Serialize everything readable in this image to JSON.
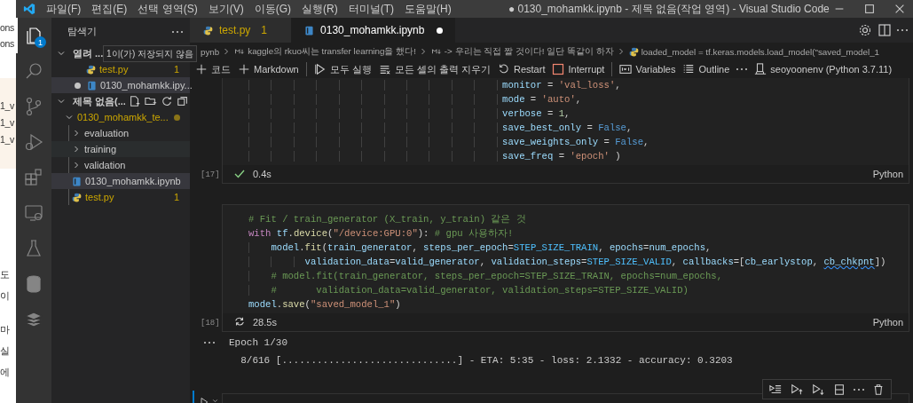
{
  "background_window": {
    "groups": [
      [
        "ons",
        "ons"
      ],
      [
        "1_v",
        "1_v",
        "1_v"
      ],
      [
        "도",
        "이",
        "마",
        "실",
        "에"
      ]
    ]
  },
  "title_bar": {
    "menus": [
      "파일(F)",
      "편집(E)",
      "선택 영역(S)",
      "보기(V)",
      "이동(G)",
      "실행(R)",
      "터미널(T)",
      "도움말(H)"
    ],
    "title": "● 0130_mohamkk.ipynb - 제목 없음(작업 영역) - Visual Studio Code"
  },
  "activity_bar": [
    {
      "kind": "files",
      "selected": true,
      "badge": "1"
    },
    {
      "kind": "search",
      "selected": false
    },
    {
      "kind": "source-control",
      "selected": false
    },
    {
      "kind": "run-debug",
      "selected": false
    },
    {
      "kind": "extensions",
      "selected": false
    },
    {
      "kind": "remote",
      "selected": false
    },
    {
      "kind": "testing",
      "selected": false
    },
    {
      "kind": "database",
      "selected": false
    },
    {
      "kind": "layers",
      "selected": false
    }
  ],
  "explorer": {
    "title": "탐색기",
    "open_editors": {
      "label": "열려 ...",
      "expanded": true,
      "tooltip": "1이(가) 저장되지 않음",
      "items": [
        {
          "name": "test.py",
          "kind": "python",
          "badge": "1",
          "warning": true,
          "dirty": false,
          "selected": false
        },
        {
          "name": "0130_mohamkk.ipy...",
          "kind": "notebook",
          "warning": false,
          "dirty": true,
          "selected": true
        }
      ]
    },
    "workspace": {
      "label": "제목 없음(...",
      "expanded": true,
      "tree": [
        {
          "name": "0130_mohamkk_te...",
          "kind": "folder",
          "expanded": true,
          "modified": true,
          "children": [
            {
              "name": "evaluation",
              "kind": "folder",
              "expanded": false,
              "warning": false,
              "selected": false,
              "hovered": false
            },
            {
              "name": "training",
              "kind": "folder",
              "expanded": false,
              "warning": false,
              "selected": false,
              "hovered": true
            },
            {
              "name": "validation",
              "kind": "folder",
              "expanded": false,
              "warning": false,
              "selected": false,
              "hovered": false
            },
            {
              "name": "0130_mohamkk.ipynb",
              "kind": "notebook",
              "warning": false,
              "selected": true,
              "hovered": false
            },
            {
              "name": "test.py",
              "kind": "python",
              "badge": "1",
              "warning": true,
              "selected": false,
              "hovered": false
            }
          ]
        }
      ]
    }
  },
  "tabs": [
    {
      "label": "test.py",
      "kind": "python",
      "badge": "1",
      "warning": true,
      "dirty": false,
      "selected": false
    },
    {
      "label": "0130_mohamkk.ipynb",
      "kind": "notebook",
      "warning": false,
      "dirty": true,
      "selected": true
    }
  ],
  "breadcrumb": [
    {
      "kind": "file",
      "text": "pynb"
    },
    {
      "kind": "markdown",
      "text": "kaggle의 rkuo씨는 transfer learning을 했다!"
    },
    {
      "kind": "markdown",
      "text": "-> 우리는 직접 짤 것이다! 일단 똑같이 하자"
    },
    {
      "kind": "code",
      "text": "loaded_model = tf.keras.models.load_model(\"saved_model_1"
    }
  ],
  "toolbar": [
    {
      "kind": "add",
      "label": "코드"
    },
    {
      "kind": "add",
      "label": "Markdown"
    },
    {
      "kind": "separator"
    },
    {
      "kind": "run-all",
      "label": "모두 실행"
    },
    {
      "kind": "clear",
      "label": "모든 셀의 출력 지우기"
    },
    {
      "kind": "restart",
      "label": "Restart"
    },
    {
      "kind": "interrupt",
      "label": "Interrupt"
    },
    {
      "kind": "separator"
    },
    {
      "kind": "variables",
      "label": "Variables"
    },
    {
      "kind": "outline",
      "label": "Outline"
    },
    {
      "kind": "more"
    },
    {
      "kind": "kernel",
      "label": "seoyoonenv (Python 3.7.11)"
    }
  ],
  "cells": [
    {
      "execution_count": "[17]",
      "running": false,
      "duration": "0.4s",
      "language": "Python",
      "lines": [
        [
          {
            "kind": "name",
            "text": "                                             monitor"
          },
          {
            "kind": "op",
            "text": " = "
          },
          {
            "kind": "string",
            "text": "'val_loss'"
          },
          {
            "kind": "op",
            "text": ","
          }
        ],
        [
          {
            "kind": "name",
            "text": "                                             mode"
          },
          {
            "kind": "op",
            "text": " = "
          },
          {
            "kind": "string",
            "text": "'auto'"
          },
          {
            "kind": "op",
            "text": ","
          }
        ],
        [
          {
            "kind": "name",
            "text": "                                             verbose"
          },
          {
            "kind": "op",
            "text": " = "
          },
          {
            "kind": "number",
            "text": "1"
          },
          {
            "kind": "op",
            "text": ","
          }
        ],
        [
          {
            "kind": "name",
            "text": "                                             save_best_only"
          },
          {
            "kind": "op",
            "text": " = "
          },
          {
            "kind": "constant",
            "text": "False"
          },
          {
            "kind": "op",
            "text": ","
          }
        ],
        [
          {
            "kind": "name",
            "text": "                                             save_weights_only"
          },
          {
            "kind": "op",
            "text": " = "
          },
          {
            "kind": "constant",
            "text": "False"
          },
          {
            "kind": "op",
            "text": ","
          }
        ],
        [
          {
            "kind": "name",
            "text": "                                             save_freq"
          },
          {
            "kind": "op",
            "text": " = "
          },
          {
            "kind": "string",
            "text": "'epoch'"
          },
          {
            "kind": "op",
            "text": " )"
          }
        ]
      ]
    },
    {
      "execution_count": "[18]",
      "running": true,
      "duration": "28.5s",
      "language": "Python",
      "lines": [
        [
          {
            "kind": "comment",
            "text": "# Fit / train_generator (X_train, y_train) 같은 것"
          }
        ],
        [
          {
            "kind": "keyword",
            "text": "with"
          },
          {
            "kind": "name",
            "text": " tf"
          },
          {
            "kind": "op",
            "text": "."
          },
          {
            "kind": "function",
            "text": "device"
          },
          {
            "kind": "op",
            "text": "("
          },
          {
            "kind": "string",
            "text": "\"/device:GPU:0\""
          },
          {
            "kind": "op",
            "text": "): "
          },
          {
            "kind": "comment",
            "text": "# gpu 사용하자!"
          }
        ],
        [
          {
            "kind": "name",
            "text": "    model"
          },
          {
            "kind": "op",
            "text": "."
          },
          {
            "kind": "function",
            "text": "fit"
          },
          {
            "kind": "op",
            "text": "("
          },
          {
            "kind": "name",
            "text": "train_generator"
          },
          {
            "kind": "op",
            "text": ", "
          },
          {
            "kind": "name",
            "text": "steps_per_epoch"
          },
          {
            "kind": "op",
            "text": "="
          },
          {
            "kind": "const",
            "text": "STEP_SIZE_TRAIN"
          },
          {
            "kind": "op",
            "text": ", "
          },
          {
            "kind": "name",
            "text": "epochs"
          },
          {
            "kind": "op",
            "text": "="
          },
          {
            "kind": "name",
            "text": "num_epochs"
          },
          {
            "kind": "op",
            "text": ","
          }
        ],
        [
          {
            "kind": "name",
            "text": "          validation_data"
          },
          {
            "kind": "op",
            "text": "="
          },
          {
            "kind": "name",
            "text": "valid_generator"
          },
          {
            "kind": "op",
            "text": ", "
          },
          {
            "kind": "name",
            "text": "validation_steps"
          },
          {
            "kind": "op",
            "text": "="
          },
          {
            "kind": "const",
            "text": "STEP_SIZE_VALID"
          },
          {
            "kind": "op",
            "text": ", "
          },
          {
            "kind": "name",
            "text": "callbacks"
          },
          {
            "kind": "op",
            "text": "=["
          },
          {
            "kind": "name",
            "text": "cb_earlystop"
          },
          {
            "kind": "op",
            "text": ", "
          },
          {
            "kind": "warning_name",
            "text": "cb_chkpnt"
          },
          {
            "kind": "op",
            "text": "])"
          }
        ],
        [
          {
            "kind": "comment",
            "text": "    # model.fit(train_generator, steps_per_epoch=STEP_SIZE_TRAIN, epochs=num_epochs,"
          }
        ],
        [
          {
            "kind": "comment",
            "text": "    #       validation_data=valid_generator, validation_steps=STEP_SIZE_VALID)"
          }
        ],
        [
          {
            "kind": "name",
            "text": "model"
          },
          {
            "kind": "op",
            "text": "."
          },
          {
            "kind": "function",
            "text": "save"
          },
          {
            "kind": "op",
            "text": "("
          },
          {
            "kind": "string",
            "text": "\"saved_model_1\""
          },
          {
            "kind": "op",
            "text": ")"
          }
        ]
      ],
      "output": [
        "Epoch 1/30",
        "  8/616 [..............................] - ETA: 5:35 - loss: 2.1332 - accuracy: 0.3203"
      ]
    }
  ]
}
